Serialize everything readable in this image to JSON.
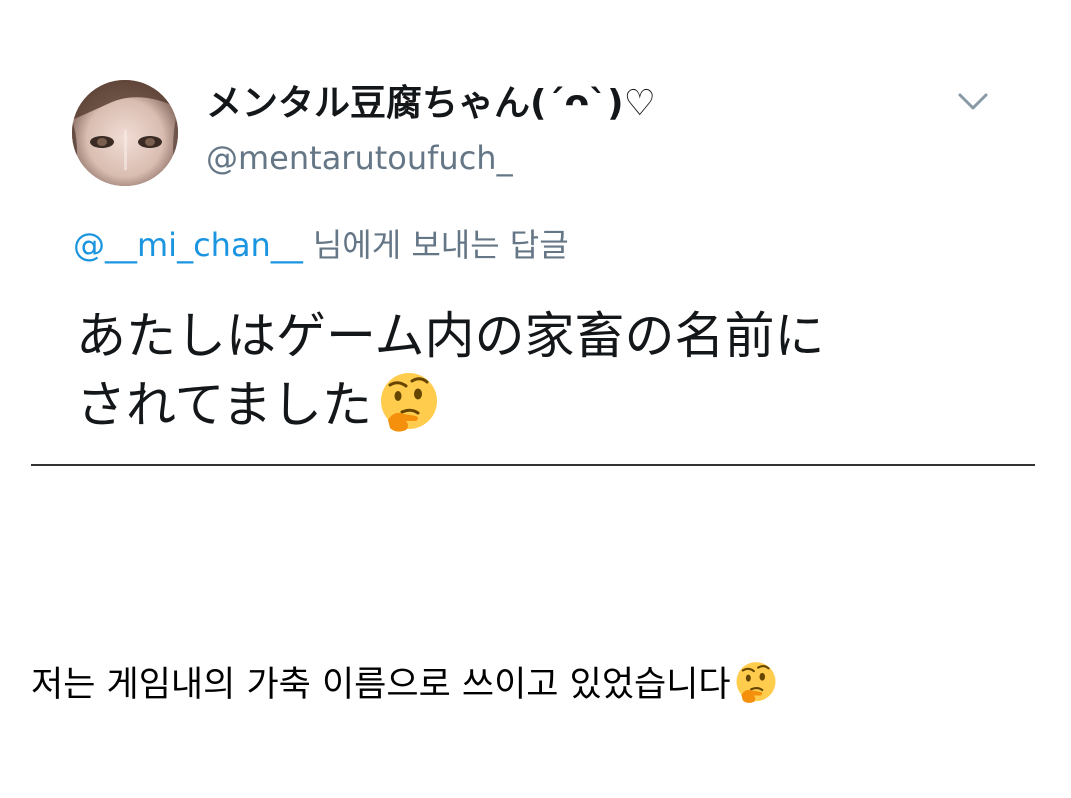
{
  "tweet": {
    "display_name": "メンタル豆腐ちゃん(´ᴖ`)♡",
    "handle": "@mentarutoufuch_",
    "reply_to": {
      "mention": "@__mi_chan__",
      "suffix": "님에게 보내는 답글"
    },
    "text_lines": [
      "あたしはゲーム内の家畜の名前に",
      "されてました"
    ],
    "emoji": "thinking-face-icon",
    "menu_icon": "chevron-down-icon"
  },
  "caption": {
    "text": "저는 게임내의 가축 이름으로 쓰이고 있었습니다",
    "emoji": "thinking-face-icon"
  },
  "colors": {
    "text": "#14171a",
    "secondary": "#657786",
    "link": "#1b95e0",
    "divider": "#333333",
    "background": "#ffffff"
  }
}
